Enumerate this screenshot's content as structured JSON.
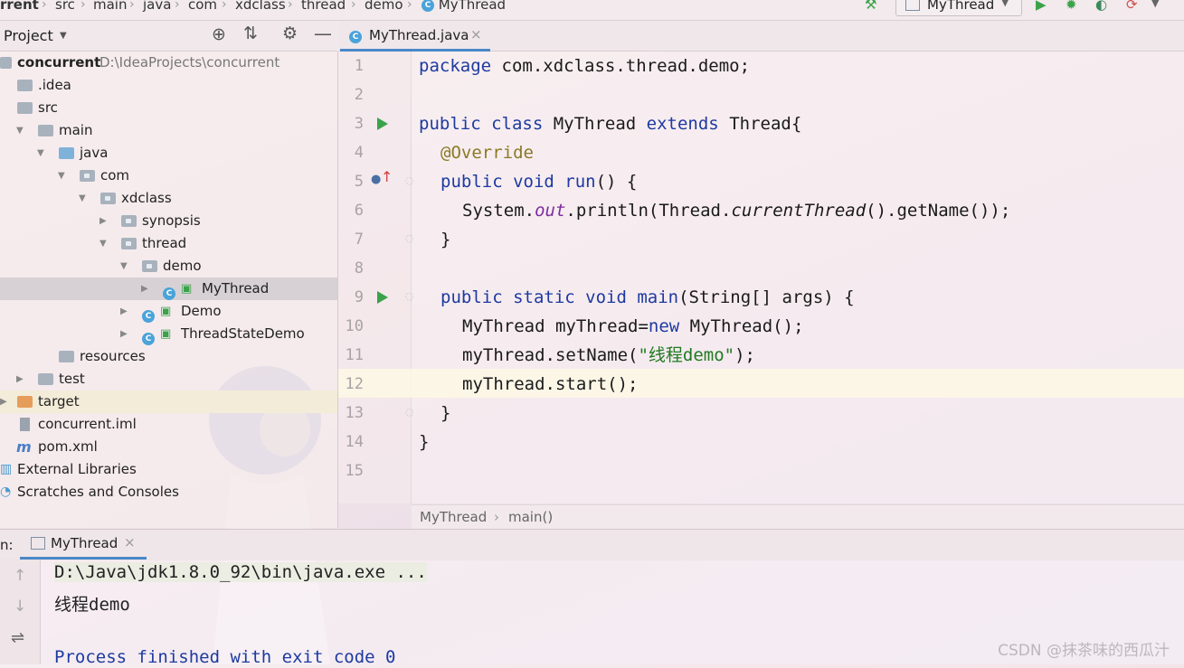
{
  "breadcrumb": [
    "rrent",
    "src",
    "main",
    "java",
    "com",
    "xdclass",
    "thread",
    "demo",
    "MyThread"
  ],
  "run_config": "MyThread",
  "project": {
    "header_label": "Project",
    "tree": [
      {
        "label": "concurrent",
        "path": "D:\\IdeaProjects\\concurrent",
        "bold": true
      },
      {
        "label": ".idea"
      },
      {
        "label": "src"
      },
      {
        "label": "main"
      },
      {
        "label": "java"
      },
      {
        "label": "com"
      },
      {
        "label": "xdclass"
      },
      {
        "label": "synopsis"
      },
      {
        "label": "thread"
      },
      {
        "label": "demo"
      },
      {
        "label": "MyThread"
      },
      {
        "label": "Demo"
      },
      {
        "label": "ThreadStateDemo"
      },
      {
        "label": "resources"
      },
      {
        "label": "test"
      },
      {
        "label": "target"
      },
      {
        "label": "concurrent.iml"
      },
      {
        "label": "pom.xml"
      },
      {
        "label": "External Libraries"
      },
      {
        "label": "Scratches and Consoles"
      }
    ]
  },
  "editor": {
    "tab_label": "MyThread.java",
    "line_numbers": [
      "1",
      "2",
      "3",
      "4",
      "5",
      "6",
      "7",
      "8",
      "9",
      "10",
      "11",
      "12",
      "13",
      "14",
      "15"
    ],
    "code": {
      "l1_kw": "package",
      "l1_rest": " com.xdclass.thread.demo;",
      "l3_kw1": "public class",
      "l3_name": " MyThread ",
      "l3_kw2": "extends",
      "l3_rest": " Thread{",
      "l4_ann": "@Override",
      "l5_kw": "public void",
      "l5_meth": " run",
      "l5_rest": "() {",
      "l6_a": "System.",
      "l6_fld": "out",
      "l6_b": ".println(Thread.",
      "l6_ital": "currentThread",
      "l6_c": "().getName());",
      "l7": "}",
      "l9_kw": "public static void",
      "l9_meth": " main",
      "l9_rest": "(String[] args) {",
      "l10_a": "MyThread myThread=",
      "l10_kw": "new",
      "l10_b": " MyThread();",
      "l11_a": "myThread.setName(",
      "l11_str": "\"线程demo\"",
      "l11_b": ");",
      "l12": "myThread.start();",
      "l13": "}",
      "l14": "}"
    },
    "breadcrumb_class": "MyThread",
    "breadcrumb_method": "main()"
  },
  "run": {
    "label": "n:",
    "tab_label": "MyThread",
    "console": [
      "D:\\Java\\jdk1.8.0_92\\bin\\java.exe ...",
      "线程demo",
      "",
      "Process finished with exit code 0"
    ]
  },
  "watermark": "CSDN @抹茶味的西瓜汁"
}
